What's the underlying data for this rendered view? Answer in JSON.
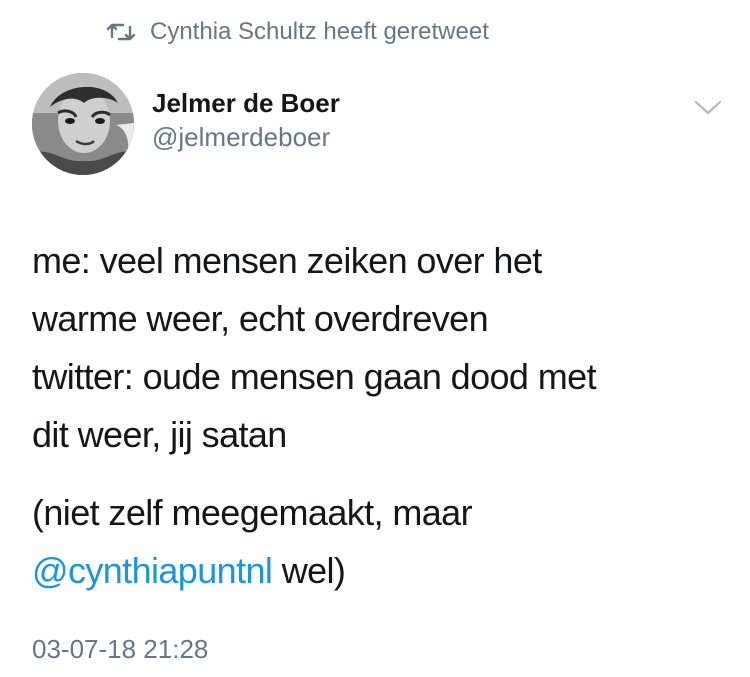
{
  "retweet": {
    "icon": "retweet-icon",
    "text": "Cynthia Schultz heeft geretweet"
  },
  "author": {
    "avatar": "avatar",
    "display_name": "Jelmer de Boer",
    "handle": "@jelmerdeboer"
  },
  "menu": {
    "icon": "chevron-down-icon"
  },
  "tweet": {
    "lines": [
      "me: veel mensen zeiken over het",
      "warme weer, echt overdreven",
      "twitter: oude mensen gaan dood met",
      "dit weer, jij satan"
    ],
    "para2_line1": "(niet zelf meegemaakt, maar",
    "mention": "@cynthiapuntnl",
    "para2_tail": " wel)"
  },
  "timestamp": "03-07-18 21:28",
  "colors": {
    "text": "#14171a",
    "secondary": "#657786",
    "link": "#1b95e0"
  }
}
